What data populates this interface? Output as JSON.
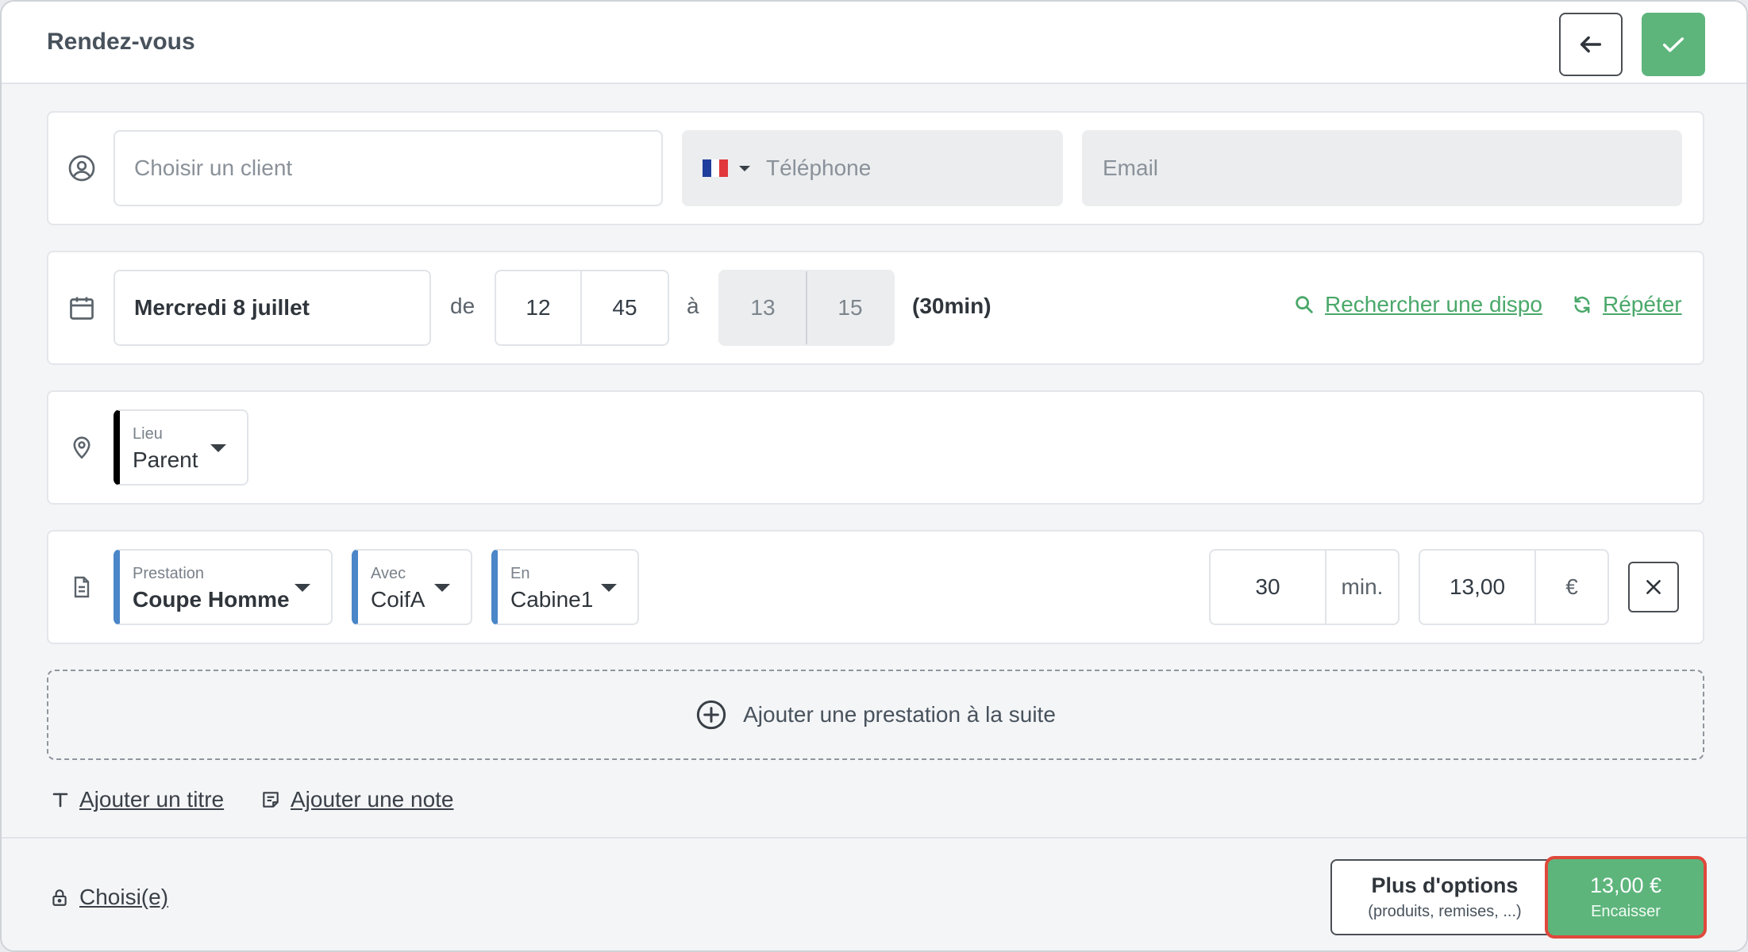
{
  "header": {
    "title": "Rendez-vous"
  },
  "client": {
    "client_placeholder": "Choisir un client",
    "phone_placeholder": "Téléphone",
    "email_placeholder": "Email"
  },
  "schedule": {
    "date": "Mercredi 8 juillet",
    "from_label": "de",
    "start_hour": "12",
    "start_minute": "45",
    "to_label": "à",
    "end_hour": "13",
    "end_minute": "15",
    "duration": "(30min)",
    "search_link": "Rechercher une dispo",
    "repeat_link": "Répéter"
  },
  "location": {
    "label": "Lieu",
    "value": "Parent"
  },
  "service": {
    "prestation_label": "Prestation",
    "prestation_value": "Coupe Homme",
    "with_label": "Avec",
    "with_value": "CoifA",
    "in_label": "En",
    "in_value": "Cabine1",
    "duration_value": "30",
    "duration_unit": "min.",
    "price_value": "13,00",
    "price_unit": "€"
  },
  "add_service": "Ajouter une prestation à la suite",
  "extras": {
    "add_title": "Ajouter un titre",
    "add_note": "Ajouter une note"
  },
  "footer": {
    "chosen_link": "Choisi(e)",
    "options_title": "Plus d'options",
    "options_sub": "(produits, remises, ...)",
    "total": "13,00 €",
    "cash_label": "Encaisser"
  },
  "colors": {
    "accent_green": "#5db57c",
    "link_green": "#4aa86a",
    "blue_marker": "#4a86c8",
    "danger_outline": "#e0483c"
  }
}
